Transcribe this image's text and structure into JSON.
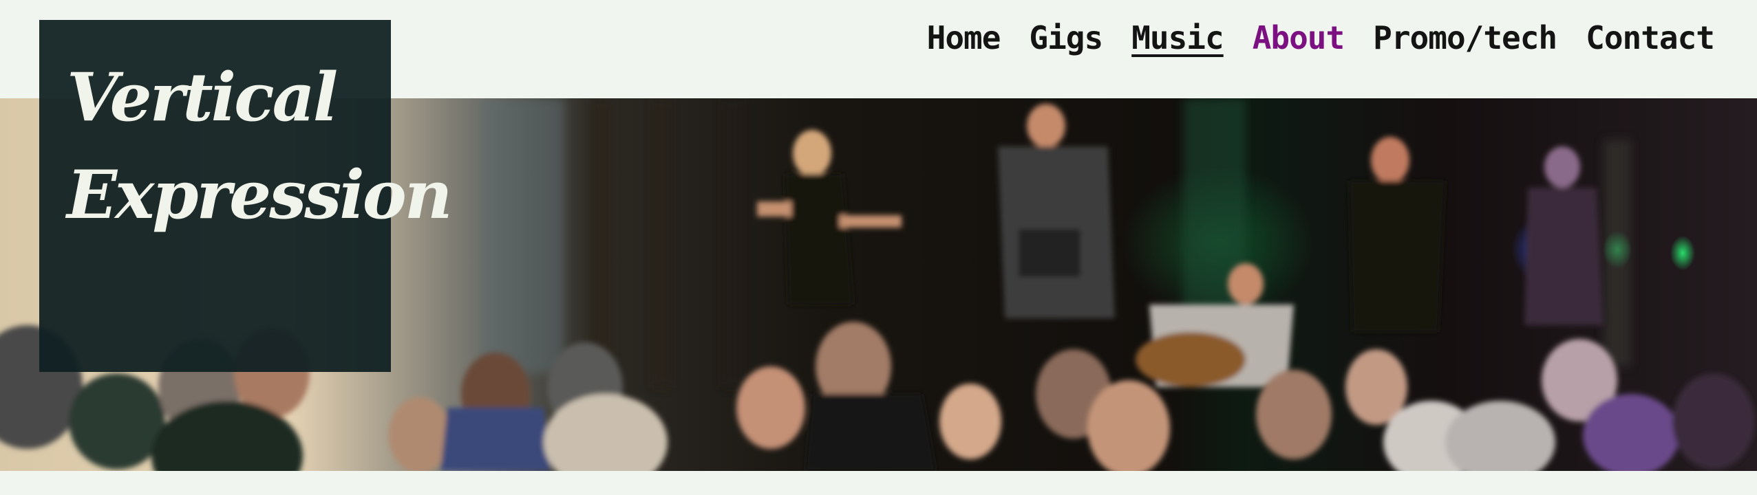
{
  "site": {
    "logo_line1": "Vertical",
    "logo_line2": "Expression"
  },
  "nav": {
    "items": [
      {
        "label": "Home",
        "state": "normal"
      },
      {
        "label": "Gigs",
        "state": "normal"
      },
      {
        "label": "Music",
        "state": "current"
      },
      {
        "label": "About",
        "state": "visited"
      },
      {
        "label": "Promo/tech",
        "state": "normal"
      },
      {
        "label": "Contact",
        "state": "normal"
      }
    ]
  },
  "hero": {
    "image_subject": "band-performing-on-stage-with-dancing-crowd"
  },
  "colors": {
    "background": "#f1f5ef",
    "logo_box": "#102022",
    "logo_text": "#f0f4ea",
    "nav_text": "#141414",
    "nav_visited": "#7b1180"
  }
}
